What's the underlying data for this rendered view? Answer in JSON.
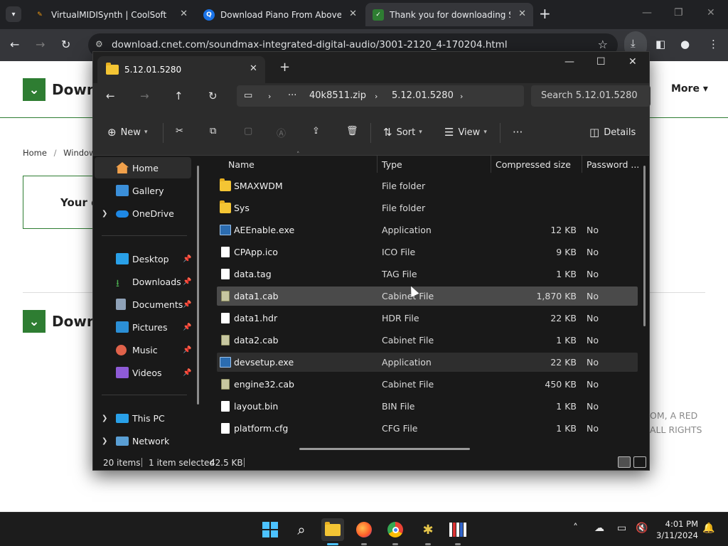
{
  "browser": {
    "tabs": [
      {
        "title": "VirtualMIDISynth | CoolSoft",
        "active": false
      },
      {
        "title": "Download Piano From Above b",
        "active": false
      },
      {
        "title": "Thank you for downloading So",
        "active": true
      }
    ],
    "url": "download.cnet.com/soundmax-integrated-digital-audio/3001-2120_4-170204.html"
  },
  "webpage": {
    "logo_text": "Down",
    "more_label": "More",
    "breadcrumb_home": "Home",
    "breadcrumb_sep": "/",
    "breadcrumb_windows": "Windows",
    "thanks_partial": "Your d",
    "footer_line1": "OM, A RED",
    "footer_line2": "ALL RIGHTS"
  },
  "explorer": {
    "tab_title": "5.12.01.5280",
    "breadcrumb": [
      "40k8511.zip",
      "5.12.01.5280"
    ],
    "breadcrumb_more": "···",
    "search_placeholder": "Search 5.12.01.5280",
    "commands": {
      "new": "New",
      "sort": "Sort",
      "view": "View",
      "more": "···",
      "details": "Details"
    },
    "nav_pane": [
      {
        "label": "Home",
        "icon": "home-icon",
        "selected": true,
        "expandable": false
      },
      {
        "label": "Gallery",
        "icon": "gallery-icon",
        "selected": false,
        "expandable": false
      },
      {
        "label": "OneDrive",
        "icon": "onedrive-icon",
        "selected": false,
        "expandable": true
      },
      {
        "label": "Desktop",
        "icon": "desktop-icon",
        "pinned": true
      },
      {
        "label": "Downloads",
        "icon": "downloads-icon",
        "pinned": true
      },
      {
        "label": "Documents",
        "icon": "documents-icon",
        "pinned": true
      },
      {
        "label": "Pictures",
        "icon": "pictures-icon",
        "pinned": true
      },
      {
        "label": "Music",
        "icon": "music-icon",
        "pinned": true
      },
      {
        "label": "Videos",
        "icon": "videos-icon",
        "pinned": true
      },
      {
        "label": "This PC",
        "icon": "pc-icon",
        "expandable": true
      },
      {
        "label": "Network",
        "icon": "network-icon",
        "expandable": true
      }
    ],
    "columns": [
      "Name",
      "Type",
      "Compressed size",
      "Password ..."
    ],
    "files": [
      {
        "name": "SMAXWDM",
        "type": "File folder",
        "size": "",
        "password": "",
        "icon": "folder"
      },
      {
        "name": "Sys",
        "type": "File folder",
        "size": "",
        "password": "",
        "icon": "folder"
      },
      {
        "name": "AEEnable.exe",
        "type": "Application",
        "size": "12 KB",
        "password": "No",
        "icon": "app"
      },
      {
        "name": "CPApp.ico",
        "type": "ICO File",
        "size": "9 KB",
        "password": "No",
        "icon": "doc"
      },
      {
        "name": "data.tag",
        "type": "TAG File",
        "size": "1 KB",
        "password": "No",
        "icon": "doc"
      },
      {
        "name": "data1.cab",
        "type": "Cabinet File",
        "size": "1,870 KB",
        "password": "No",
        "icon": "cab"
      },
      {
        "name": "data1.hdr",
        "type": "HDR File",
        "size": "22 KB",
        "password": "No",
        "icon": "doc"
      },
      {
        "name": "data2.cab",
        "type": "Cabinet File",
        "size": "1 KB",
        "password": "No",
        "icon": "cab"
      },
      {
        "name": "devsetup.exe",
        "type": "Application",
        "size": "22 KB",
        "password": "No",
        "icon": "app"
      },
      {
        "name": "engine32.cab",
        "type": "Cabinet File",
        "size": "450 KB",
        "password": "No",
        "icon": "cab"
      },
      {
        "name": "layout.bin",
        "type": "BIN File",
        "size": "1 KB",
        "password": "No",
        "icon": "doc"
      },
      {
        "name": "platform.cfg",
        "type": "CFG File",
        "size": "1 KB",
        "password": "No",
        "icon": "doc"
      }
    ],
    "status": {
      "item_count": "20 items",
      "selection": "1 item selected",
      "selection_size": "42.5 KB"
    }
  },
  "taskbar": {
    "time": "4:01 PM",
    "date": "3/11/2024"
  }
}
